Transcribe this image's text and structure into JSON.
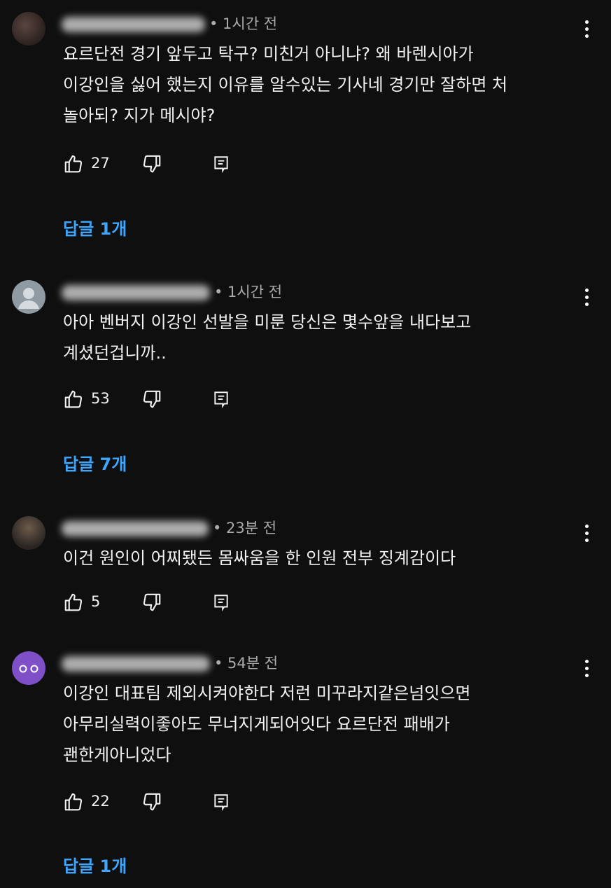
{
  "comments": [
    {
      "time": "• 1시간 전",
      "text": "요르단전 경기 앞두고 탁구? 미친거 아니냐?  왜 바렌시아가\n이강인을 싫어 했는지 이유를  알수있는 기사네  경기만 잘하면 처\n놀아되? 지가 메시야?",
      "likes": "27",
      "replies": "답글 1개"
    },
    {
      "time": "• 1시간 전",
      "text": "아아 벤버지 이강인 선발을 미룬 당신은 몇수앞을 내다보고\n계셨던겁니까..",
      "likes": "53",
      "replies": "답글 7개"
    },
    {
      "time": "• 23분 전",
      "text": "이건 원인이 어찌됐든 몸싸움을 한 인원 전부 징계감이다",
      "likes": "5",
      "replies": ""
    },
    {
      "time": "• 54분 전",
      "text": "이강인 대표팀 제외시켜야한다 저런 미꾸라지같은넘잇으면\n아무리실력이좋아도 무너지게되어잇다 요르단전 패배가\n괜한게아니었다",
      "likes": "22",
      "replies": "답글 1개"
    }
  ],
  "icons": {
    "like": "thumbs-up-icon",
    "dislike": "thumbs-down-icon",
    "reply": "comment-reply-icon",
    "more": "more-vert-icon"
  },
  "colors": {
    "background": "#0f0f0f",
    "text": "#f1f1f1",
    "meta": "#aaaaaa",
    "link": "#3ea6ff"
  }
}
